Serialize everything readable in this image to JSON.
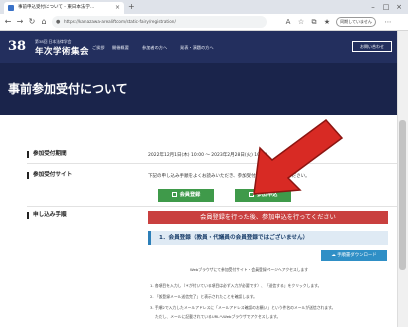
{
  "browser": {
    "tab_title": "事前申込受付について - 東日本法学…",
    "tab_close": "×",
    "new_tab": "+",
    "url": "https://kanazawa-arealiftcom/static-fairy/registration/",
    "profile_label": "同期していません",
    "window_controls": [
      "–",
      "□",
      "×"
    ],
    "nav_back": "←",
    "nav_forward": "→",
    "nav_reload": "↻",
    "nav_home": "⌂"
  },
  "site": {
    "logo_number": "38",
    "logo_sub": "第38回 日本法律学会",
    "logo_main": "年次学術集会",
    "nav": [
      "ご挨拶",
      "開催概要",
      "参加者の方へ",
      "発表・演題の方へ"
    ],
    "contact_label": "お問い合わせ",
    "page_title": "事前参加受付について"
  },
  "rows": {
    "period_label": "参加受付期間",
    "period_value": "2022年12月1日(木) 10:00 ～ 2023年2月28日(火) 10:00",
    "site_label": "参加受付サイト",
    "site_value": "下記の申し込み手順をよくお読みいただき、参加受付サイトにお進みください。",
    "btn_register": "会員登録",
    "btn_apply": "参加申込",
    "procedure_label": "申し込み手順"
  },
  "procedure": {
    "banner": "会員登録を行った後、参加申込を行ってください",
    "step1": "1．会員登録（教員・代議員の会員登録ではございません）",
    "manual_button": "手順書ダウンロード",
    "intro": "Webブラウザにて参加受付サイト・会員登録ページへアクセスします",
    "notes": [
      "1. 各項目を入力し（＊が付いている項目は必ず入力が必要です）、「送信する」をクリックします。",
      "2. 「仮登録メール送信完了」と表示されたことを確認します。",
      "3. 手順2で入力したメールアドレスに「メールアドレス確認のお願い」という件名のメールが送信されます。",
      "　 ただし、メールに記載されているURLへWebブラウザでアクセスします。"
    ]
  }
}
